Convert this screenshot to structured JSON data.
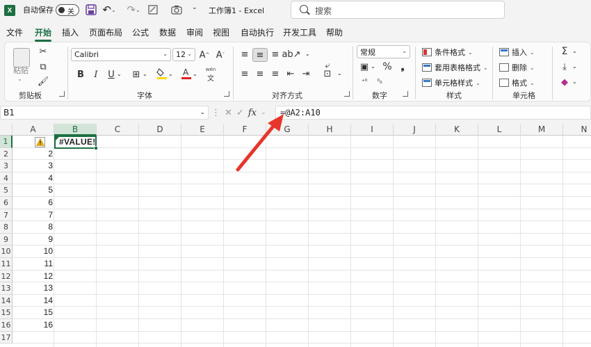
{
  "titlebar": {
    "autosave_label": "自动保存",
    "autosave_state": "关",
    "doc_title": "工作簿1  -  Excel",
    "search_placeholder": "搜索"
  },
  "menu": {
    "tabs": [
      "文件",
      "开始",
      "插入",
      "页面布局",
      "公式",
      "数据",
      "审阅",
      "视图",
      "自动执行",
      "开发工具",
      "帮助"
    ],
    "active": "开始"
  },
  "ribbon": {
    "clipboard": {
      "paste": "粘贴",
      "label": "剪贴板"
    },
    "font": {
      "name": "Calibri",
      "size": "12",
      "bold": "B",
      "italic": "I",
      "underline": "U",
      "label": "字体",
      "phonetic": "wén"
    },
    "alignment": {
      "label": "对齐方式"
    },
    "number": {
      "format": "常规",
      "label": "数字",
      "percent": "%"
    },
    "styles": {
      "conditional": "条件格式",
      "table": "套用表格格式",
      "cell": "单元格样式",
      "label": "样式"
    },
    "cells": {
      "insert": "插入",
      "delete": "删除",
      "format": "格式",
      "label": "单元格"
    },
    "editing": {
      "sum": "Σ"
    }
  },
  "formula_bar": {
    "name_box": "B1",
    "fx": "fx",
    "formula": "=@A2:A10"
  },
  "grid": {
    "columns": [
      "A",
      "B",
      "C",
      "D",
      "E",
      "F",
      "G",
      "H",
      "I",
      "J",
      "K",
      "L",
      "M",
      "N"
    ],
    "selected_column": "B",
    "rows": [
      "1",
      "2",
      "3",
      "4",
      "5",
      "6",
      "7",
      "8",
      "9",
      "10",
      "11",
      "12",
      "13",
      "14",
      "15",
      "16",
      "17"
    ],
    "selected_row": "1",
    "col_a_values": [
      "",
      "2",
      "3",
      "4",
      "5",
      "6",
      "7",
      "8",
      "9",
      "10",
      "11",
      "12",
      "13",
      "14",
      "15",
      "16",
      ""
    ],
    "b1_value": "#VALUE!"
  },
  "colors": {
    "accent": "#1d6f42",
    "arrow": "#e8352b"
  }
}
